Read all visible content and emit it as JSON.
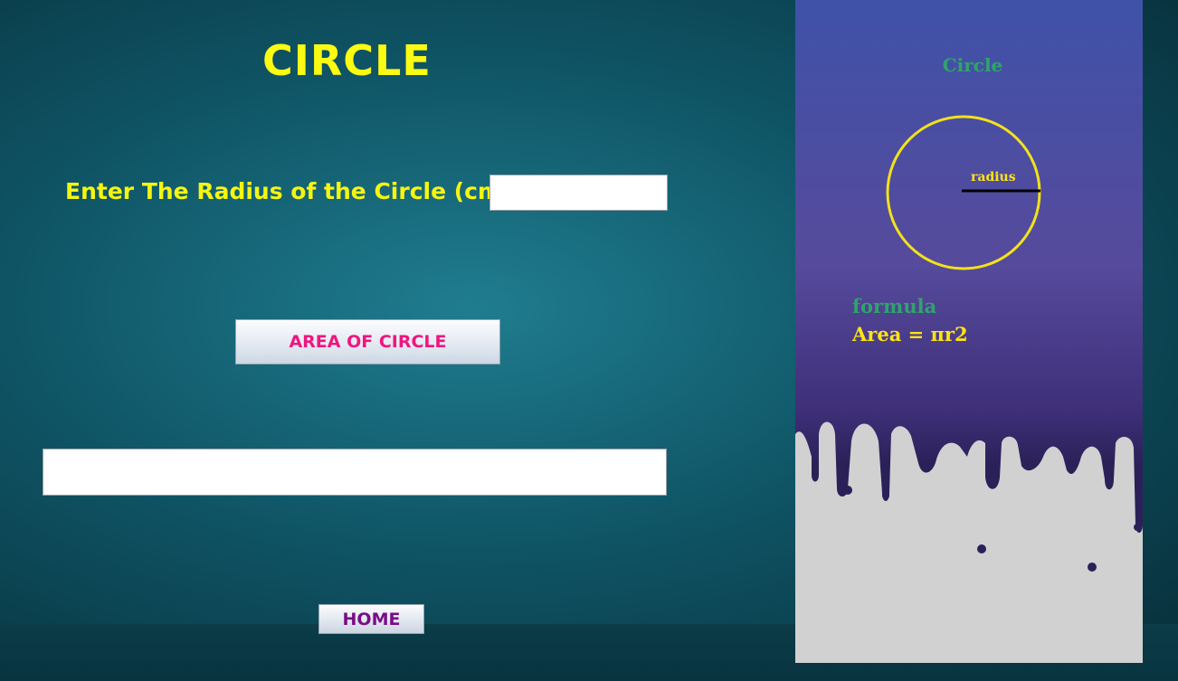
{
  "page": {
    "title": "CIRCLE"
  },
  "form": {
    "radius_label": "Enter The Radius of the Circle (cm):",
    "radius_value": "",
    "area_button_label": "AREA OF CIRCLE",
    "result_value": "",
    "home_button_label": "HOME"
  },
  "info_panel": {
    "heading": "Circle",
    "radius_label": "radius",
    "formula_label": "formula",
    "formula_text": "Area = πr2"
  },
  "colors": {
    "title": "#fafa12",
    "area_button_text": "#f0157f",
    "home_button_text": "#7a0d86",
    "panel_heading": "#2fa46a",
    "circle_stroke": "#f2e21a"
  }
}
